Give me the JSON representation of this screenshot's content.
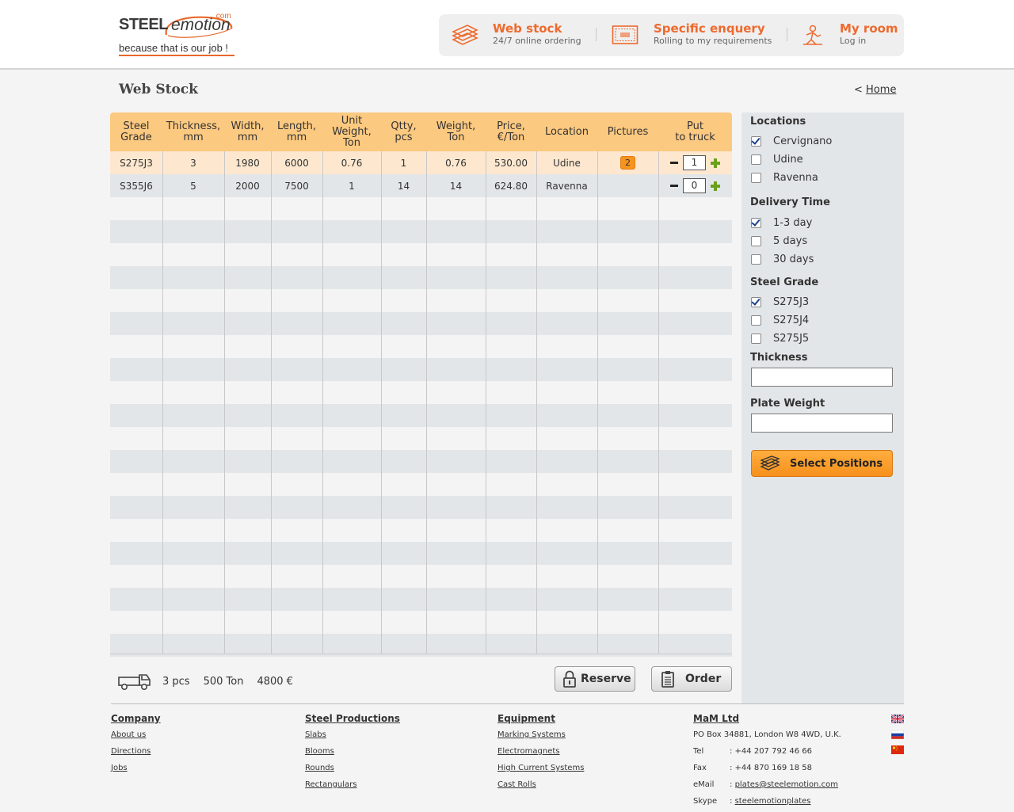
{
  "logo": {
    "word1": "STEEL",
    "word2": "emotion",
    "dotcom": ".com",
    "tagline": "because that is our job !"
  },
  "topnav": [
    {
      "title": "Web stock",
      "subtitle": "24/7 online ordering",
      "icon": "stack-icon"
    },
    {
      "title": "Specific enquery",
      "subtitle": "Rolling to my requirements",
      "icon": "certificate-icon"
    },
    {
      "title": "My room",
      "subtitle": "Log in",
      "icon": "worker-icon"
    }
  ],
  "page": {
    "title": "Web Stock",
    "home_prefix": "<",
    "home_label": "Home"
  },
  "table": {
    "headers": [
      "Steel\nGrade",
      "Thickness,\nmm",
      "Width,\nmm",
      "Length,\nmm",
      "Unit\nWeight,\nTon",
      "Qtty,\npcs",
      "Weight,\nTon",
      "Price,\n€/Ton",
      "Location",
      "Pictures",
      "Put\nto truck"
    ],
    "rows": [
      {
        "grade": "S275J3",
        "thickness": "3",
        "width": "1980",
        "length": "6000",
        "unit_weight": "0.76",
        "qtty": "1",
        "weight": "0.76",
        "price": "530.00",
        "location": "Udine",
        "pictures": "2",
        "truck_qty": "1"
      },
      {
        "grade": "S355J6",
        "thickness": "5",
        "width": "2000",
        "length": "7500",
        "unit_weight": "1",
        "qtty": "14",
        "weight": "14",
        "price": "624.80",
        "location": "Ravenna",
        "pictures": "",
        "truck_qty": "0"
      }
    ]
  },
  "sidebar": {
    "locations": {
      "title": "Locations",
      "options": [
        {
          "label": "Cervignano",
          "checked": true
        },
        {
          "label": "Udine",
          "checked": false
        },
        {
          "label": "Ravenna",
          "checked": false
        }
      ]
    },
    "delivery": {
      "title": "Delivery Time",
      "options": [
        {
          "label": "1-3 day",
          "checked": true
        },
        {
          "label": "5 days",
          "checked": false
        },
        {
          "label": "30 days",
          "checked": false
        }
      ]
    },
    "grade": {
      "title": "Steel Grade",
      "options": [
        {
          "label": "S275J3",
          "checked": true
        },
        {
          "label": "S275J4",
          "checked": false
        },
        {
          "label": "S275J5",
          "checked": false
        }
      ]
    },
    "thickness": {
      "title": "Thickness",
      "value": ""
    },
    "plate_weight": {
      "title": "Plate Weight",
      "value": ""
    },
    "select_button": "Select Positions"
  },
  "summary": {
    "pcs": "3 pcs",
    "ton": "500 Ton",
    "eur": "4800 €"
  },
  "actions": {
    "reserve": "Reserve",
    "order": "Order"
  },
  "footer": {
    "company": {
      "title": "Company",
      "links": [
        "About us",
        "Directions",
        "Jobs"
      ]
    },
    "steel": {
      "title": "Steel Productions",
      "links": [
        "Slabs",
        "Blooms",
        "Rounds",
        "Rectangulars"
      ]
    },
    "equipment": {
      "title": "Equipment",
      "links": [
        "Marking Systems",
        "Electromagnets",
        "High Current Systems",
        "Cast Rolls"
      ]
    },
    "contact": {
      "title": "MaM Ltd",
      "address": "PO Box 34881, London W8 4WD, U.K.",
      "tel_label": "Tel",
      "tel": ": +44 207 792 46 66",
      "fax_label": "Fax",
      "fax": ": +44 870 169 18 58",
      "email_label": "eMail",
      "email": "plates@steelemotion.com",
      "skype_label": "Skype",
      "skype": "steelemotionplates"
    },
    "languages": [
      "english-flag-icon",
      "russian-flag-icon",
      "chinese-flag-icon"
    ]
  },
  "colors": {
    "accent": "#ee6a2e",
    "header_row": "#fcc980",
    "badge": "#f7941d",
    "plus": "#6aa01a",
    "sidebar_bg": "#e3e6e8"
  }
}
